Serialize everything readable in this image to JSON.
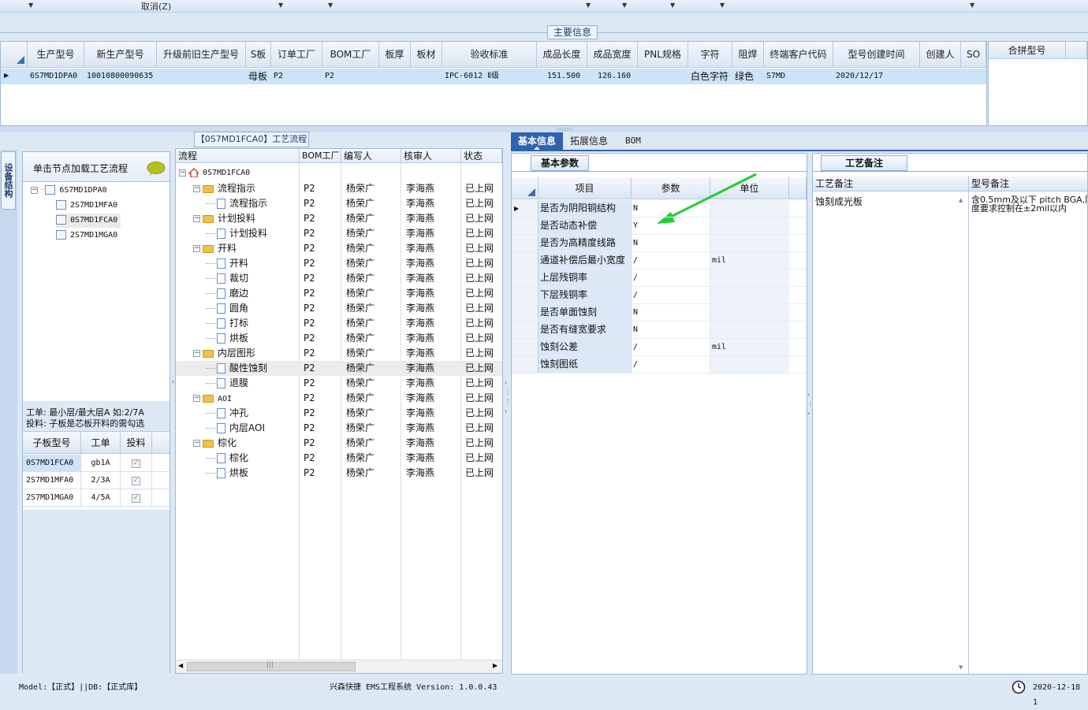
{
  "toolbar": {
    "cancel_label": "取消(Z)"
  },
  "main_info": {
    "section_title": "主要信息",
    "columns": [
      "生产型号",
      "新生产型号",
      "升级前旧生产型号",
      "S板",
      "订单工厂",
      "BOM工厂",
      "板厚",
      "板材",
      "验收标准",
      "成品长度",
      "成品宽度",
      "PNL规格",
      "字符",
      "阻焊",
      "终端客户代码",
      "型号创建时间",
      "创建人",
      "SO"
    ],
    "row": {
      "prod_model": "6S7MD1DPA0",
      "new_model": "10010800090635",
      "old_model": "",
      "s_board": "母板",
      "order_factory": "P2",
      "bom_factory": "P2",
      "thickness": "",
      "material": "",
      "standard": "IPC-6012 Ⅱ级",
      "length": "151.500",
      "width": "126.160",
      "pnl": "",
      "char": "白色字符",
      "solder": "绿色",
      "customer": "S7MD",
      "created": "2020/12/17",
      "creator": "",
      "so": ""
    },
    "merge_header": "合拼型号"
  },
  "left": {
    "vertical_tab": "设备结构",
    "hint": "单击节点加载工艺流程",
    "tree": {
      "root": "6S7MD1DPA0",
      "children": [
        "2S7MD1MFA0",
        "0S7MD1FCA0",
        "2S7MD1MGA0"
      ]
    },
    "note_line1": "工单: 最小层/最大层A 如:2/7A",
    "note_line2": "投料: 子板是芯板开料的需勾选",
    "sub_table": {
      "headers": [
        "子板型号",
        "工单",
        "投料"
      ],
      "rows": [
        {
          "model": "0S7MD1FCA0",
          "order": "gb1A"
        },
        {
          "model": "2S7MD1MFA0",
          "order": "2/3A"
        },
        {
          "model": "2S7MD1MGA0",
          "order": "4/5A"
        }
      ]
    }
  },
  "process": {
    "tab_title": "【0S7MD1FCA0】工艺流程",
    "headers": [
      "流程",
      "BOM工厂",
      "编写人",
      "核审人",
      "状态"
    ],
    "root": "0S7MD1FCA0",
    "rows": [
      {
        "level": 1,
        "name": "流程指示",
        "folder": true
      },
      {
        "level": 2,
        "name": "流程指示"
      },
      {
        "level": 1,
        "name": "计划投料",
        "folder": true
      },
      {
        "level": 2,
        "name": "计划投料"
      },
      {
        "level": 1,
        "name": "开料",
        "folder": true
      },
      {
        "level": 2,
        "name": "开料"
      },
      {
        "level": 2,
        "name": "裁切"
      },
      {
        "level": 2,
        "name": "磨边"
      },
      {
        "level": 2,
        "name": "圆角"
      },
      {
        "level": 2,
        "name": "打标"
      },
      {
        "level": 2,
        "name": "烘板"
      },
      {
        "level": 1,
        "name": "内层图形",
        "folder": true
      },
      {
        "level": 2,
        "name": "酸性蚀刻",
        "selected": true
      },
      {
        "level": 2,
        "name": "退膜"
      },
      {
        "level": 1,
        "name": "AOI",
        "folder": true
      },
      {
        "level": 2,
        "name": "冲孔"
      },
      {
        "level": 2,
        "name": "内层AOI"
      },
      {
        "level": 1,
        "name": "棕化",
        "folder": true
      },
      {
        "level": 2,
        "name": "棕化"
      },
      {
        "level": 2,
        "name": "烘板"
      }
    ],
    "factory": "P2",
    "writer": "杨荣广",
    "reviewer": "李海燕",
    "status": "已上网",
    "scroll_glyph": "|||"
  },
  "tabs": {
    "basic": "基本信息",
    "extend": "拓展信息",
    "bom": "BOM"
  },
  "basic": {
    "subtab": "基本参数",
    "headers": [
      "项目",
      "参数",
      "单位"
    ],
    "rows": [
      {
        "item": "是否为阴阳铜结构",
        "param": "N",
        "unit": ""
      },
      {
        "item": "是否动态补偿",
        "param": "Y",
        "unit": ""
      },
      {
        "item": "是否为高精度线路",
        "param": "N",
        "unit": ""
      },
      {
        "item": "通道补偿后最小宽度",
        "param": "/",
        "unit": "mil"
      },
      {
        "item": "上层残铜率",
        "param": "/",
        "unit": ""
      },
      {
        "item": "下层残铜率",
        "param": "/",
        "unit": ""
      },
      {
        "item": "是否单面蚀刻",
        "param": "N",
        "unit": ""
      },
      {
        "item": "是否有缝宽要求",
        "param": "N",
        "unit": ""
      },
      {
        "item": "蚀刻公差",
        "param": "/",
        "unit": "mil"
      },
      {
        "item": "蚀刻图纸",
        "param": "/",
        "unit": ""
      }
    ]
  },
  "notes": {
    "tab": "工艺备注",
    "col1": "工艺备注",
    "col2": "型号备注",
    "note1": "蚀刻成光板",
    "note2a": "含0.5mm及以下 pitch BGA,阻",
    "note2b": "度要求控制在±2mil以内"
  },
  "status": {
    "left": "Model:【正式】||DB:【正式库】",
    "center": "兴森快捷 EMS工程系统 Version: 1.0.0.43",
    "date": "2020-12-18 1"
  },
  "colors": {
    "accent": "#2d64b0",
    "selection": "#cde3f8",
    "arrow": "#22cc33"
  }
}
